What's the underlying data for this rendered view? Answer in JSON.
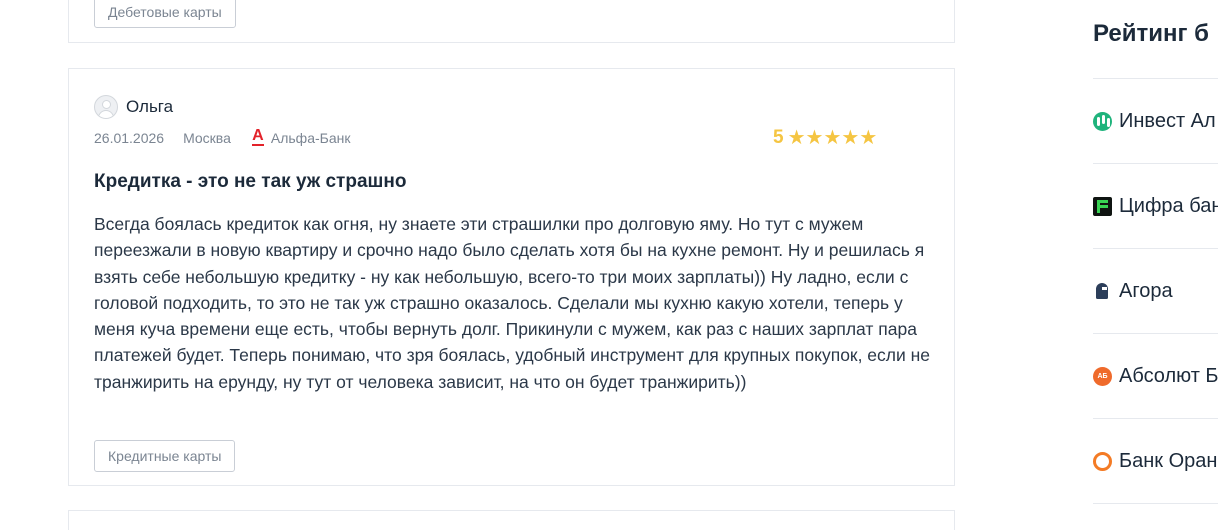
{
  "previous_review": {
    "tag_label": "Дебетовые карты"
  },
  "review": {
    "author": "Ольга",
    "date": "26.01.2026",
    "city": "Москва",
    "bank": "Альфа-Банк",
    "rating_value": "5",
    "stars": 5,
    "title": "Кредитка - это не так уж страшно",
    "text": "Всегда боялась кредиток как огня, ну знаете эти страшилки про долговую яму. Но тут с мужем переезжали в новую квартиру и срочно надо было сделать хотя бы на кухне ремонт. Ну и решилась я взять себе небольшую кредитку - ну как небольшую, всего-то три моих зарплаты)) Ну ладно, если с головой подходить, то это не так уж страшно оказалось. Сделали мы кухню какую хотели, теперь у меня куча времени еще есть, чтобы вернуть долг. Прикинули с мужем, как раз с наших зарплат пара платежей будет. Теперь понимаю, что зря боялась, удобный инструмент для крупных покупок, если не транжирить на ерунду, ну тут от человека зависит, на что он будет транжирить))",
    "tag_label": "Кредитные карты"
  },
  "sidebar": {
    "title": "Рейтинг б",
    "items": [
      {
        "label": "Инвест Ал",
        "icon": "invest-logo-icon"
      },
      {
        "label": "Цифра бан",
        "icon": "cifra-logo-icon"
      },
      {
        "label": "Агора",
        "icon": "agora-logo-icon"
      },
      {
        "label": "Абсолют Б",
        "icon": "absolut-logo-icon"
      },
      {
        "label": "Банк Оран",
        "icon": "orange-logo-icon"
      }
    ]
  },
  "colors": {
    "star": "#f5c542",
    "alfa_red": "#e3222a",
    "border": "#e6e9ee",
    "text": "#1c2a3a"
  }
}
